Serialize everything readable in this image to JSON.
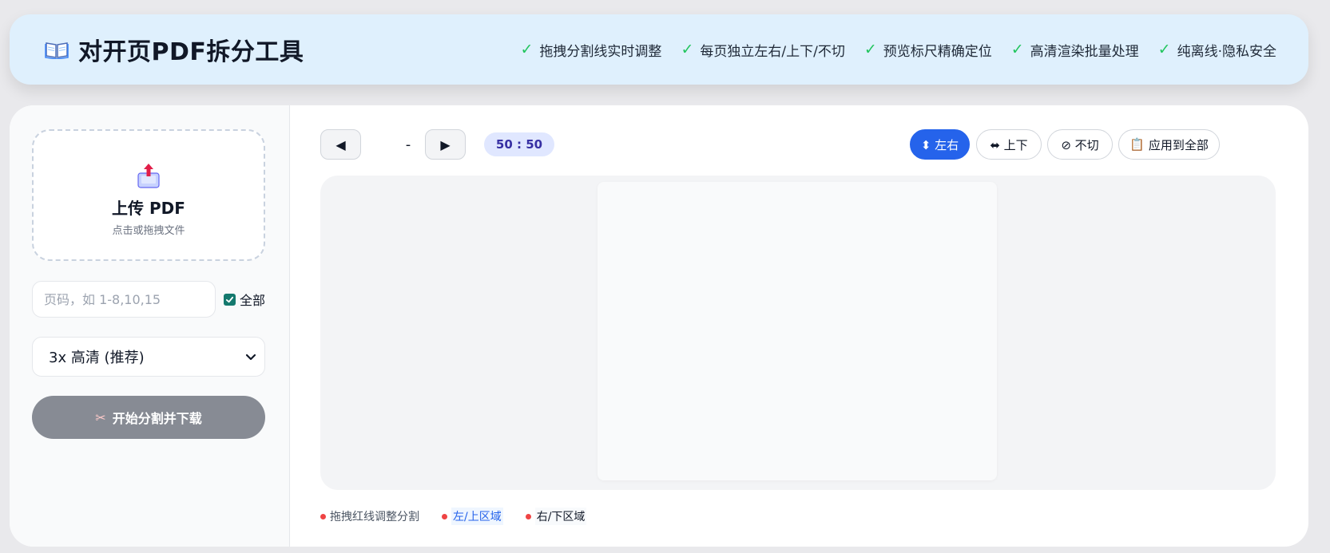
{
  "header": {
    "title": "对开页PDF拆分工具",
    "features": [
      "拖拽分割线实时调整",
      "每页独立左右/上下/不切",
      "预览标尺精确定位",
      "高清渲染批量处理",
      "纯离线·隐私安全"
    ]
  },
  "sidebar": {
    "upload_title": "上传 PDF",
    "upload_hint": "点击或拖拽文件",
    "range_placeholder": "页码，如 1-8,10,15",
    "all_label": "全部",
    "all_checked": true,
    "quality_selected": "3x 高清 (推荐)",
    "start_label": "开始分割并下载"
  },
  "toolbar": {
    "prev_glyph": "◀",
    "page_indicator": "-",
    "next_glyph": "▶",
    "ratio": "50 : 50",
    "mode_lr": "⬍ 左右",
    "mode_tb": "⬌ 上下",
    "mode_none": "⊘ 不切",
    "apply_all": "应用到全部"
  },
  "legend": {
    "drag": "拖拽红线调整分割",
    "left_top": "左/上区域",
    "right_bottom": "右/下区域"
  },
  "colors": {
    "accent": "#2563eb",
    "check": "#22c55e",
    "split_line": "#ef4444",
    "header_bg": "#dff0fd"
  }
}
